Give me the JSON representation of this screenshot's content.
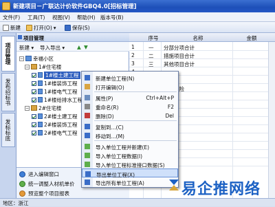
{
  "window": {
    "title": "新建项目－广联达计价软件GBQ4.0[招标管理]"
  },
  "menu": [
    "文件(F)",
    "工具(T)",
    "视图(V)",
    "帮助(H)",
    "版本号(B)"
  ],
  "toolbar": {
    "new": "新建",
    "open": "打开(O)",
    "save": "保存(S)"
  },
  "side_tabs": [
    "项目管理",
    "发布招标书",
    "发标标底"
  ],
  "left_panel": {
    "title": "项目管理",
    "new_label": "新建 ▾",
    "import_export": "导入导出 ▾",
    "tree": [
      {
        "label": "幸福小区",
        "level": 0
      },
      {
        "label": "1#住宅楼",
        "level": 1
      },
      {
        "label": "1#楼土建工程",
        "level": 2,
        "selected": true
      },
      {
        "label": "1#楼装饰工程",
        "level": 2
      },
      {
        "label": "1#楼电气工程",
        "level": 2
      },
      {
        "label": "1#楼给排水工程",
        "level": 2
      },
      {
        "label": "2#住宅楼",
        "level": 1
      },
      {
        "label": "2#楼土建工程",
        "level": 2
      },
      {
        "label": "2#楼装饰工程",
        "level": 2
      },
      {
        "label": "2#楼电气工程",
        "level": 2
      }
    ],
    "actions": [
      "进入编辑窗口",
      "统一调整人材机单价",
      "预览整个项目报表"
    ]
  },
  "table": {
    "headers": [
      "序号",
      "名称",
      "金额"
    ],
    "rows": [
      {
        "num": "1",
        "seq": "一",
        "name": "分部分项合计"
      },
      {
        "num": "2",
        "seq": "二",
        "name": "措施项目合计"
      },
      {
        "num": "3",
        "seq": "三",
        "name": "其他项目合计"
      },
      {
        "num": "4",
        "seq": "",
        "name": ""
      },
      {
        "num": "5",
        "seq": "",
        "name": ""
      },
      {
        "num": "6",
        "seq": "",
        "name": "工伤保险"
      },
      {
        "num": "7",
        "seq": "",
        "name": ""
      },
      {
        "num": "8",
        "seq": "",
        "name": ""
      },
      {
        "num": "9",
        "seq": "",
        "name": ""
      },
      {
        "num": "10",
        "seq": "",
        "name": ""
      },
      {
        "num": "11",
        "seq": "",
        "name": ""
      },
      {
        "num": "12",
        "seq": "",
        "name": ""
      },
      {
        "num": "13",
        "seq": "",
        "name": ""
      },
      {
        "num": "14",
        "seq": "",
        "name": ""
      },
      {
        "num": "15",
        "seq": "",
        "name": ""
      }
    ]
  },
  "context_menu": [
    {
      "label": "新建单位工程(N)",
      "shortcut": ""
    },
    {
      "label": "打开编辑(O)",
      "shortcut": ""
    },
    {
      "label": "属性(P)",
      "shortcut": "Ctrl+Alt+P"
    },
    {
      "label": "重命名(R)",
      "shortcut": "F2"
    },
    {
      "label": "删除(D)",
      "shortcut": "Del"
    },
    {
      "label": "复制到...(C)",
      "shortcut": ""
    },
    {
      "label": "移动到...(M)",
      "shortcut": ""
    },
    {
      "label": "导入单位工程并新建(E)",
      "shortcut": ""
    },
    {
      "label": "导入单位工程数据(I)",
      "shortcut": ""
    },
    {
      "label": "导入单位工程标准接口数据(S)",
      "shortcut": ""
    },
    {
      "label": "导出单位工程(X)",
      "shortcut": "",
      "highlighted": true
    },
    {
      "label": "导出所有单位工程(A)",
      "shortcut": ""
    }
  ],
  "status": {
    "region": "地区：浙江"
  },
  "watermark": {
    "text": "易企推网络"
  },
  "colors": {
    "accent": "#2f5fbf",
    "title_bar": "#1d4fb8",
    "watermark": "#1d62c4"
  }
}
